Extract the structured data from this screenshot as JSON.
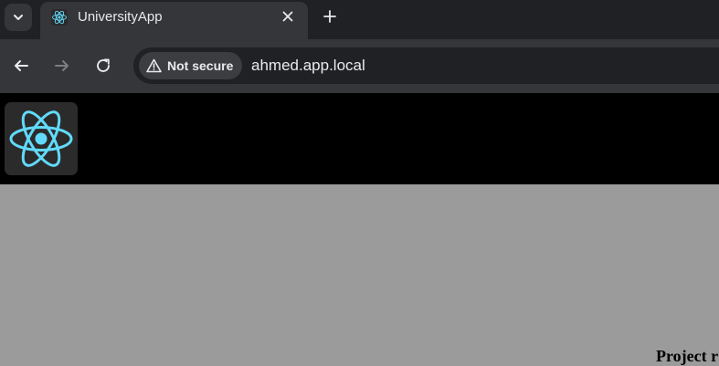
{
  "browser": {
    "tab": {
      "title": "UniversityApp",
      "favicon": "react-icon"
    },
    "icons": {
      "tab_menu": "chevron-down-icon",
      "close": "close-icon",
      "new_tab": "plus-icon",
      "back": "arrow-left-icon",
      "forward": "arrow-right-icon",
      "reload": "reload-icon",
      "warning": "warning-icon"
    },
    "omnibox": {
      "security_label": "Not secure",
      "url": "ahmed.app.local"
    }
  },
  "page": {
    "logo": "react-logo-icon",
    "body_text": "Project r"
  },
  "colors": {
    "tabstrip_bg": "#202124",
    "toolbar_bg": "#35363a",
    "header_bg": "#000000",
    "body_bg": "#9b9b9b",
    "react_cyan": "#61dafb"
  }
}
